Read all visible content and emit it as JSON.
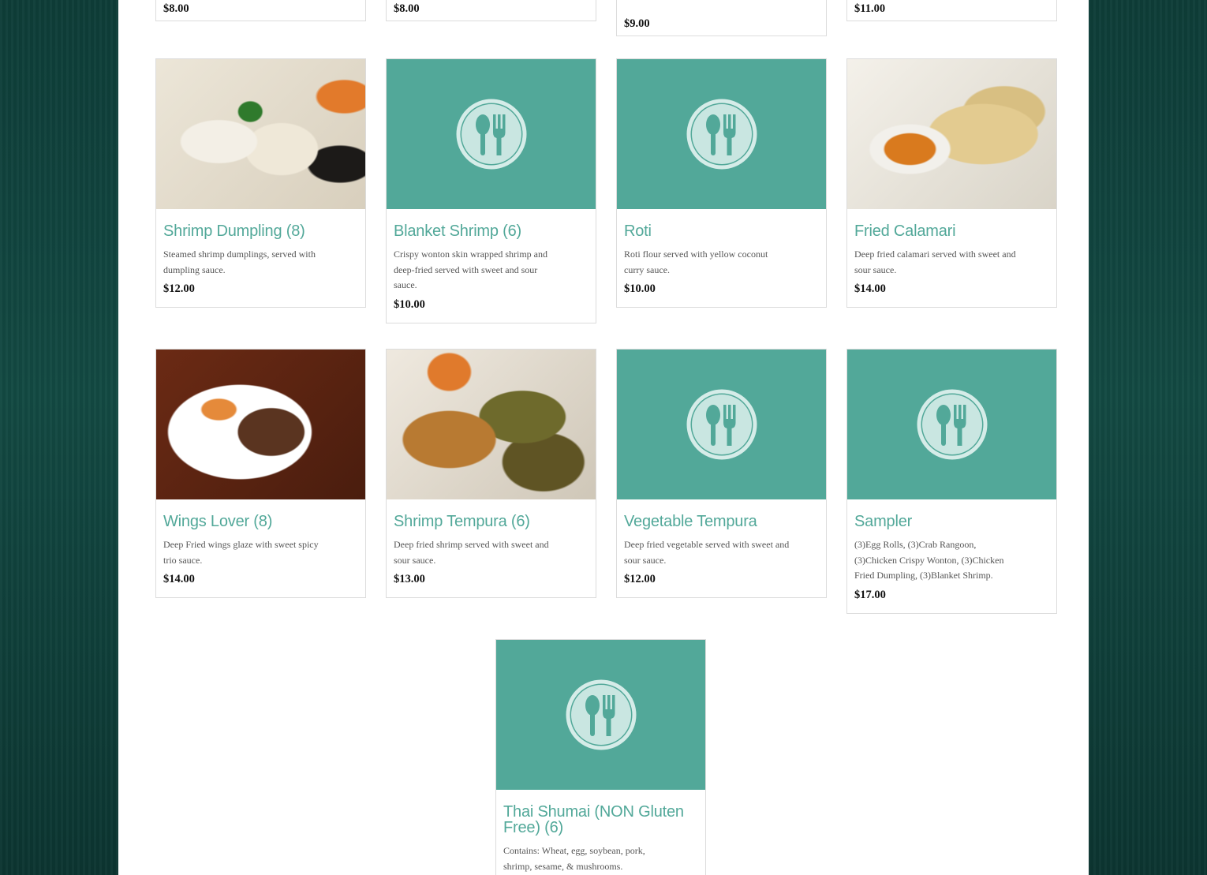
{
  "top_row": [
    {
      "price": "$8.00"
    },
    {
      "price": "$8.00"
    },
    {
      "price": "$9.00"
    },
    {
      "price": "$11.00"
    }
  ],
  "items": [
    {
      "title": "Shrimp Dumpling (8)",
      "desc": "Steamed shrimp dumplings, served with dumpling sauce.",
      "price": "$12.00"
    },
    {
      "title": "Blanket Shrimp (6)",
      "desc": "Crispy wonton skin wrapped shrimp and deep-fried served with sweet and sour sauce.",
      "price": "$10.00"
    },
    {
      "title": "Roti",
      "desc": "Roti flour served with yellow coconut curry sauce.",
      "price": "$10.00"
    },
    {
      "title": "Fried Calamari",
      "desc": "Deep fried calamari served with sweet and sour sauce.",
      "price": "$14.00"
    },
    {
      "title": "Wings Lover (8)",
      "desc": "Deep Fried wings glaze with sweet spicy trio sauce.",
      "price": "$14.00"
    },
    {
      "title": "Shrimp Tempura (6)",
      "desc": "Deep fried shrimp served with sweet and sour sauce.",
      "price": "$13.00"
    },
    {
      "title": "Vegetable Tempura",
      "desc": "Deep fried vegetable served with sweet and sour sauce.",
      "price": "$12.00"
    },
    {
      "title": "Sampler",
      "desc": "(3)Egg Rolls, (3)Crab Rangoon, (3)Chicken Crispy Wonton, (3)Chicken Fried Dumpling, (3)Blanket Shrimp.",
      "price": "$17.00"
    },
    {
      "title": "Thai Shumai (NON Gluten Free) (6)",
      "desc": "Contains: Wheat, egg, soybean, pork, shrimp, sesame, & mushrooms.",
      "price": ""
    }
  ],
  "colors": {
    "accent": "#52a899",
    "price": "#111111",
    "background": "#134a43"
  },
  "placeholder_icon": "spoon-fork-icon"
}
